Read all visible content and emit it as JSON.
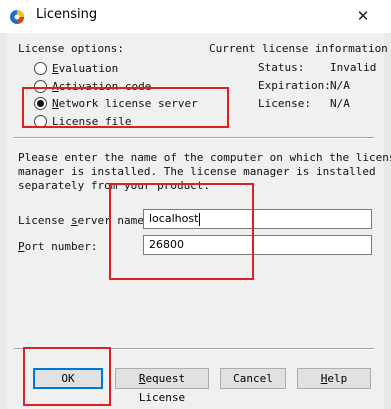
{
  "window": {
    "title": "Licensing",
    "close_glyph": "✕"
  },
  "license_options": {
    "heading": "License options:",
    "options": [
      {
        "label": "Evaluation",
        "selected": false
      },
      {
        "label": "Activation code",
        "selected": false
      },
      {
        "label": "Network license server",
        "selected": true
      },
      {
        "label": "License file",
        "selected": false
      }
    ]
  },
  "current_license": {
    "heading": "Current license information",
    "status_label": "Status:",
    "status_value": "Invalid",
    "expiration_label": "Expiration:",
    "expiration_value": "N/A",
    "license_label": "License:",
    "license_value": "N/A"
  },
  "instructions": "Please enter the name of the computer on which the license\nmanager is installed. The license manager is installed\nseparately from your product.",
  "server": {
    "name_label": "License server name:",
    "name_value": "localhost",
    "port_label": "Port number:",
    "port_value": "26800"
  },
  "buttons": {
    "ok": "OK",
    "request": "Request License",
    "cancel": "Cancel",
    "help": "Help"
  },
  "colors": {
    "annotation": "#e02020",
    "default_button": "#0078d7"
  }
}
